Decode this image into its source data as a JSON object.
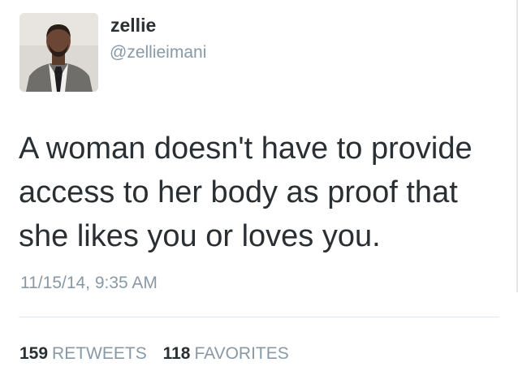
{
  "user": {
    "display_name": "zellie",
    "handle": "@zellieimani"
  },
  "tweet": {
    "text": "A woman doesn't have to provide access to her body as proof that she likes you or loves you.",
    "timestamp": "11/15/14, 9:35 AM"
  },
  "stats": {
    "retweets_count": "159",
    "retweets_label": "RETWEETS",
    "favorites_count": "118",
    "favorites_label": "FAVORITES"
  },
  "colors": {
    "text": "#292f33",
    "muted": "#8899a6",
    "divider": "#e1e8ed"
  }
}
